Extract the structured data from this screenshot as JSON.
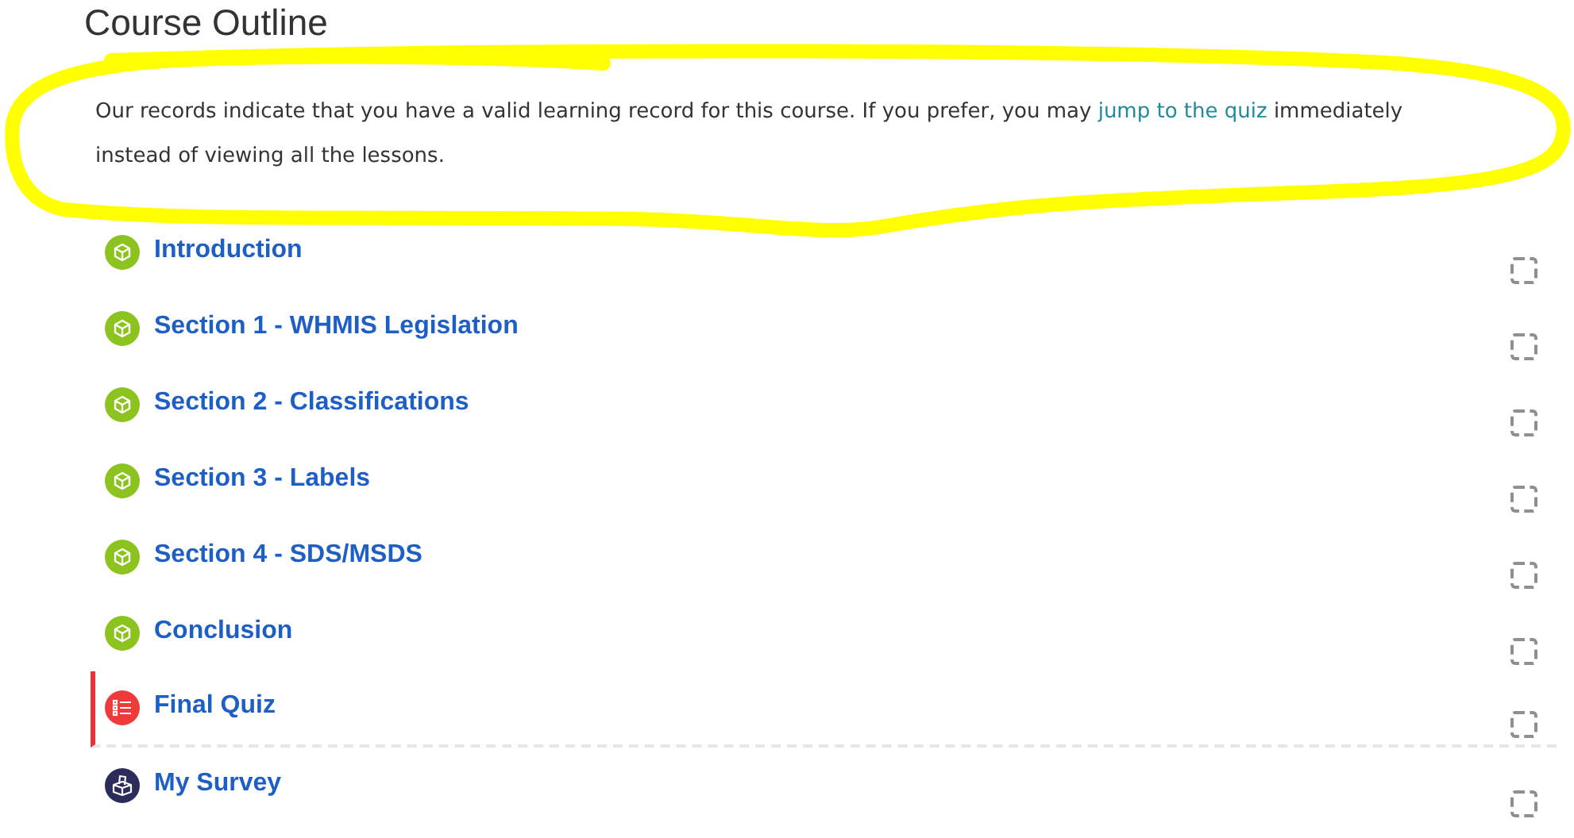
{
  "heading": "Course Outline",
  "notice": {
    "before": "Our records indicate that you have a valid learning record for this course. If you prefer, you may ",
    "link": "jump to the quiz",
    "after": " immediately instead of viewing all the lessons."
  },
  "outline": [
    {
      "kind": "lesson",
      "title": "Introduction",
      "current": false,
      "completed": false
    },
    {
      "kind": "lesson",
      "title": "Section 1 - WHMIS Legislation",
      "current": false,
      "completed": false
    },
    {
      "kind": "lesson",
      "title": "Section 2 - Classifications",
      "current": false,
      "completed": false
    },
    {
      "kind": "lesson",
      "title": "Section 3 - Labels",
      "current": false,
      "completed": false
    },
    {
      "kind": "lesson",
      "title": "Section 4 - SDS/MSDS",
      "current": false,
      "completed": false
    },
    {
      "kind": "lesson",
      "title": "Conclusion",
      "current": false,
      "completed": false
    },
    {
      "kind": "quiz",
      "title": "Final Quiz",
      "current": true,
      "completed": false
    },
    {
      "kind": "survey",
      "title": "My Survey",
      "current": false,
      "completed": false
    }
  ]
}
